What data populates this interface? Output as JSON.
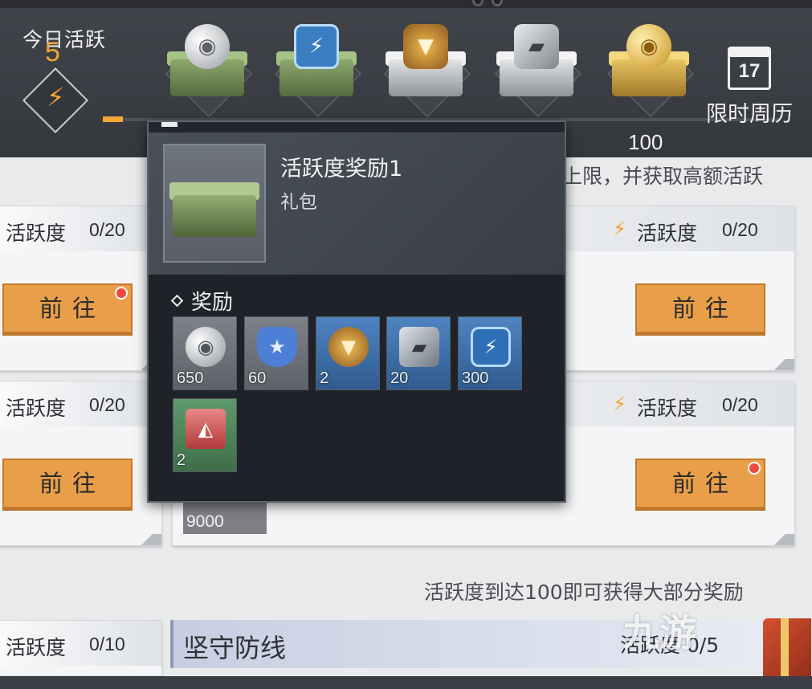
{
  "header": {
    "activity_title": "今日活跃",
    "activity_value": "5",
    "progress_fraction": 0.03,
    "max_value": "100",
    "calendar_day": "17",
    "calendar_label": "限时周历"
  },
  "chests": [
    {
      "name": "green-coin-chest",
      "style": "green",
      "emblem": "coin"
    },
    {
      "name": "green-energy-chest",
      "style": "green",
      "emblem": "bolt"
    },
    {
      "name": "white-badge-chest",
      "style": "white",
      "emblem": "badge"
    },
    {
      "name": "white-armor-chest",
      "style": "white",
      "emblem": "plate"
    },
    {
      "name": "gold-coin-chest",
      "style": "gold",
      "emblem": "gold"
    }
  ],
  "background": {
    "hint_top": "上限，并获取高额活跃",
    "cards": [
      {
        "label": "活跃度",
        "count": "0/20",
        "button": "前往",
        "notify": true
      },
      {
        "label": "活跃度",
        "count": "0/20",
        "button": "前往",
        "notify": false
      },
      {
        "label": "活跃度",
        "count": "0/20",
        "button": "前往",
        "notify": false
      },
      {
        "label": "活跃度",
        "count": "0/20",
        "button": "前往",
        "notify": true
      },
      {
        "label": "活跃度",
        "count": "0/10"
      }
    ],
    "reward_chip": "9000",
    "hint_bottom": "活跃度到达100即可获得大部分奖励",
    "section_title": "坚守防线",
    "section_right": "活跃度 0/5",
    "watermark": "九游"
  },
  "popup": {
    "title": "活跃度奖励1",
    "subtitle": "礼包",
    "rewards_label": "奖励",
    "rewards": [
      {
        "icon": "silver-coin-icon",
        "qty": "650",
        "bg": "gray"
      },
      {
        "icon": "shield-star-icon",
        "qty": "60",
        "bg": "gray"
      },
      {
        "icon": "gold-badge-icon",
        "qty": "2",
        "bg": "blue"
      },
      {
        "icon": "armor-plate-icon",
        "qty": "20",
        "bg": "blue"
      },
      {
        "icon": "energy-bolt-icon",
        "qty": "300",
        "bg": "blue"
      },
      {
        "icon": "gift-bag-icon",
        "qty": "2",
        "bg": "green"
      }
    ]
  },
  "colors": {
    "accent_orange": "#f2a637",
    "button_orange": "#e99f49",
    "notify_red": "#ee4a42",
    "popup_bg": "#2a2e35"
  }
}
